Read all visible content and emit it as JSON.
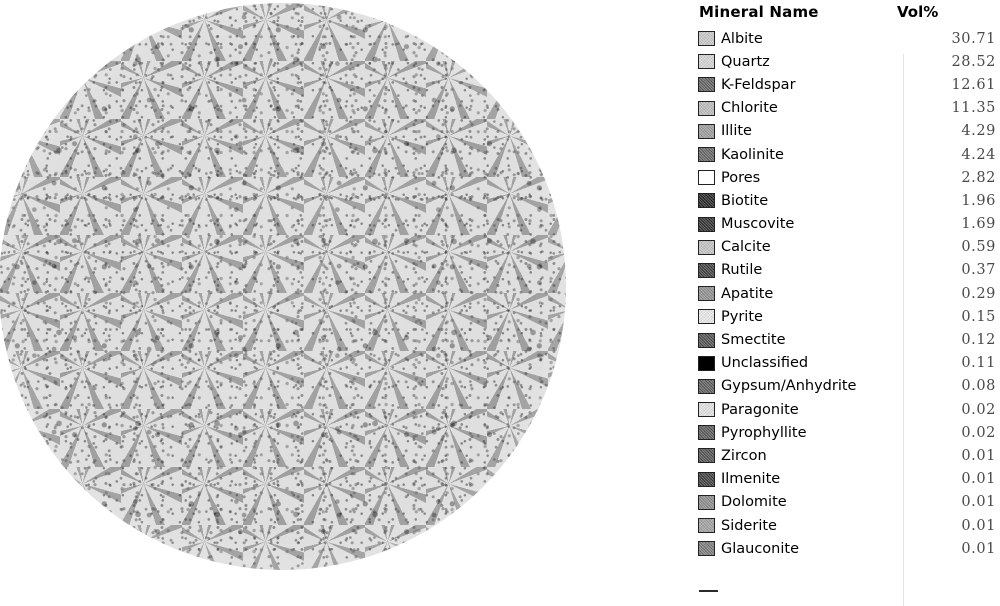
{
  "image": {
    "description": "circular rock thin-section mineral map",
    "matrix_color": "#d9d9d9",
    "speckle_color": "#707070",
    "dark_grain_color": "#4a4a4a"
  },
  "legend": {
    "headers": {
      "mineral_name": "Mineral Name",
      "vol_percent": "Vol%"
    },
    "rows": [
      {
        "name": "Albite",
        "value": "30.71",
        "color": "#c9c9c9"
      },
      {
        "name": "Quartz",
        "value": "28.52",
        "color": "#d6d6d6"
      },
      {
        "name": "K-Feldspar",
        "value": "12.61",
        "color": "#5e5e5e"
      },
      {
        "name": "Chlorite",
        "value": "11.35",
        "color": "#bdbdbd"
      },
      {
        "name": "Illite",
        "value": "4.29",
        "color": "#9b9b9b"
      },
      {
        "name": "Kaolinite",
        "value": "4.24",
        "color": "#636363"
      },
      {
        "name": "Pores",
        "value": "2.82",
        "color": "#ffffff"
      },
      {
        "name": "Biotite",
        "value": "1.96",
        "color": "#1f1f1f"
      },
      {
        "name": "Muscovite",
        "value": "1.69",
        "color": "#2b2b2b"
      },
      {
        "name": "Calcite",
        "value": "0.59",
        "color": "#c4c4c4"
      },
      {
        "name": "Rutile",
        "value": "0.37",
        "color": "#3b3b3b"
      },
      {
        "name": "Apatite",
        "value": "0.29",
        "color": "#8e8e8e"
      },
      {
        "name": "Pyrite",
        "value": "0.15",
        "color": "#ececec"
      },
      {
        "name": "Smectite",
        "value": "0.12",
        "color": "#4d4d4d"
      },
      {
        "name": "Unclassified",
        "value": "0.11",
        "color": "#000000"
      },
      {
        "name": "Gypsum/Anhydrite",
        "value": "0.08",
        "color": "#5a5a5a"
      },
      {
        "name": "Paragonite",
        "value": "0.02",
        "color": "#e4e4e4"
      },
      {
        "name": "Pyrophyllite",
        "value": "0.02",
        "color": "#565656"
      },
      {
        "name": "Zircon",
        "value": "0.01",
        "color": "#4f4f4f"
      },
      {
        "name": "Ilmenite",
        "value": "0.01",
        "color": "#3a3a3a"
      },
      {
        "name": "Dolomite",
        "value": "0.01",
        "color": "#8a8a8a"
      },
      {
        "name": "Siderite",
        "value": "0.01",
        "color": "#a0a0a0"
      },
      {
        "name": "Glauconite",
        "value": "0.01",
        "color": "#787878"
      }
    ]
  }
}
